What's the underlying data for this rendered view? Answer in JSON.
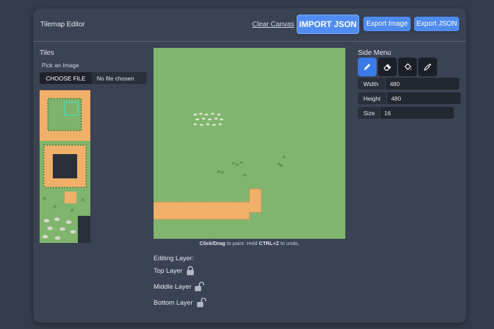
{
  "header": {
    "title": "Tilemap Editor",
    "clear_label": "Clear Canvas",
    "import_label": "IMPORT JSON",
    "export_image_label": "Export Image",
    "export_json_label": "Export JSON"
  },
  "tiles": {
    "heading": "Tiles",
    "pick_label": "Pick an Image",
    "choose_button": "CHOOSE FILE",
    "file_status": "No file chosen"
  },
  "canvas": {
    "hint_bold1": "Click/Drag",
    "hint_mid": " to paint. Hold ",
    "hint_bold2": "CTRL+Z",
    "hint_end": " to undo,"
  },
  "layers": {
    "heading": "Editing Layer:",
    "items": [
      {
        "label": "Top Layer",
        "locked": true
      },
      {
        "label": "Middle Layer",
        "locked": false
      },
      {
        "label": "Bottom Layer",
        "locked": false
      }
    ]
  },
  "side_menu": {
    "heading": "Side Menu",
    "tools": [
      "pencil-icon",
      "eraser-icon",
      "fill-bucket-icon",
      "eyedropper-icon"
    ],
    "active_tool": "pencil-icon",
    "width_label": "Width",
    "width_value": "480",
    "height_label": "Height",
    "height_value": "480",
    "size_label": "Size",
    "size_value": "16"
  },
  "colors": {
    "accent": "#4f8cf0",
    "grass": "#80b56e",
    "path": "#f0b06a",
    "background": "#343b4a",
    "card": "#3a4253"
  }
}
